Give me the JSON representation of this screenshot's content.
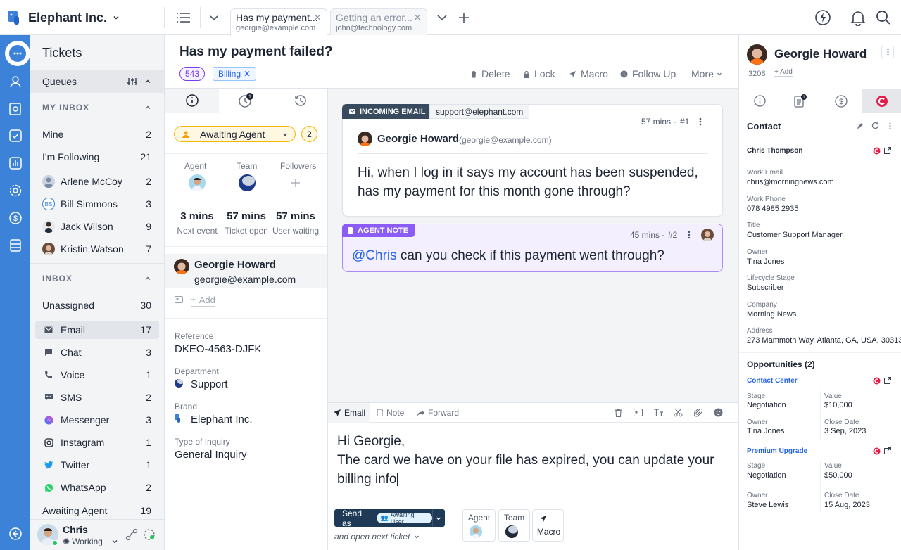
{
  "app": {
    "company": "Elephant Inc.",
    "accent": "#3b82d8"
  },
  "tabs": [
    {
      "title": "Has my payment...",
      "subtitle": "georgie@example.com",
      "active": true
    },
    {
      "title": "Getting an error...",
      "subtitle": "john@technology.com",
      "active": false
    }
  ],
  "sidebar": {
    "title": "Tickets",
    "queues_label": "Queues",
    "my_inbox_label": "MY INBOX",
    "inbox_label": "INBOX",
    "my_inbox": [
      {
        "label": "Mine",
        "count": "2"
      },
      {
        "label": "I'm Following",
        "count": "21"
      },
      {
        "label": "Arlene McCoy",
        "count": "2"
      },
      {
        "label": "Bill Simmons",
        "count": "3",
        "initials": "BS"
      },
      {
        "label": "Jack Wilson",
        "count": "9"
      },
      {
        "label": "Kristin Watson",
        "count": "7"
      }
    ],
    "inbox": [
      {
        "label": "Unassigned",
        "count": "30"
      },
      {
        "label": "Email",
        "count": "17",
        "icon": "envelope-icon"
      },
      {
        "label": "Chat",
        "count": "3",
        "icon": "chat-icon"
      },
      {
        "label": "Voice",
        "count": "1",
        "icon": "phone-icon"
      },
      {
        "label": "SMS",
        "count": "2",
        "icon": "sms-icon"
      },
      {
        "label": "Messenger",
        "count": "3",
        "icon": "messenger-icon"
      },
      {
        "label": "Instagram",
        "count": "1",
        "icon": "instagram-icon"
      },
      {
        "label": "Twitter",
        "count": "1",
        "icon": "twitter-icon"
      },
      {
        "label": "WhatsApp",
        "count": "2",
        "icon": "whatsapp-icon"
      },
      {
        "label": "Awaiting Agent",
        "count": "19"
      }
    ],
    "user": {
      "name": "Chris",
      "status": "Working"
    }
  },
  "ticket": {
    "title": "Has my payment failed?",
    "id": "543",
    "label": "Billing",
    "actions": [
      "Delete",
      "Lock",
      "Macro",
      "Follow Up",
      "More"
    ]
  },
  "props": {
    "status": "Awaiting Agent",
    "status_count": "2",
    "agent_label": "Agent",
    "team_label": "Team",
    "followers_label": "Followers",
    "timers": [
      {
        "value": "3 mins",
        "label": "Next event"
      },
      {
        "value": "57 mins",
        "label": "Ticket open"
      },
      {
        "value": "57 mins",
        "label": "User waiting"
      }
    ],
    "requester_name": "Georgie Howard",
    "requester_email": "georgie@example.com",
    "add_label": "Add",
    "fields": [
      {
        "label": "Reference",
        "value": "DKEO-4563-DJFK"
      },
      {
        "label": "Department",
        "value": "Support"
      },
      {
        "label": "Brand",
        "value": "Elephant Inc."
      },
      {
        "label": "Type of Inquiry",
        "value": "General Inquiry"
      }
    ]
  },
  "messages": {
    "email_tag": "INCOMING EMAIL",
    "email_to": "support@elephant.com",
    "email_time": "57 mins",
    "email_num": "#1",
    "email_from": "Georgie Howard",
    "email_from_addr": "(georgie@example.com)",
    "email_line1": "Hi, when I log in it says my account has been suspended,",
    "email_line2": "has my payment for this month gone through?",
    "note_tag": "AGENT NOTE",
    "note_time": "45 mins",
    "note_num": "#2",
    "note_mention": "@Chris",
    "note_text": " can you check if this payment went through?"
  },
  "composer": {
    "tabs": [
      "Email",
      "Note",
      "Forward"
    ],
    "line1": "Hi Georgie,",
    "line2": "The card we have on your file has expired, you can update your",
    "line3": "billing info",
    "send_label": "Send as",
    "send_status": "Awaiting User",
    "next_label": "and open next ticket",
    "agent_label": "Agent",
    "team_label": "Team",
    "macro_label": "Macro"
  },
  "contact": {
    "name": "Georgie Howard",
    "id": "3208",
    "add_label": "+ Add",
    "section": "Contact",
    "person": "Chris Thompson",
    "fields": [
      {
        "label": "Work Email",
        "value": "chris@morningnews.com"
      },
      {
        "label": "Work Phone",
        "value": "078 4985 2935"
      },
      {
        "label": "Title",
        "value": "Customer Support Manager"
      },
      {
        "label": "Owner",
        "value": "Tina Jones"
      },
      {
        "label": "Lifecycle Stage",
        "value": "Subscriber"
      },
      {
        "label": "Company",
        "value": "Morning News"
      },
      {
        "label": "Address",
        "value": "273 Mammoth Way, Atlanta, GA, USA, 30313"
      }
    ],
    "opps_title": "Opportunities (2)",
    "opps": [
      {
        "name": "Contact Center",
        "stage": "Negotiation",
        "value": "$10,000",
        "owner": "Tina Jones",
        "close": "3 Sep, 2023"
      },
      {
        "name": "Premium Upgrade",
        "stage": "Negotiation",
        "value": "$50,000",
        "owner": "Steve Lewis",
        "close": "15 Aug, 2023"
      }
    ],
    "labels": {
      "stage": "Stage",
      "value": "Value",
      "owner": "Owner",
      "close": "Close Date"
    }
  }
}
